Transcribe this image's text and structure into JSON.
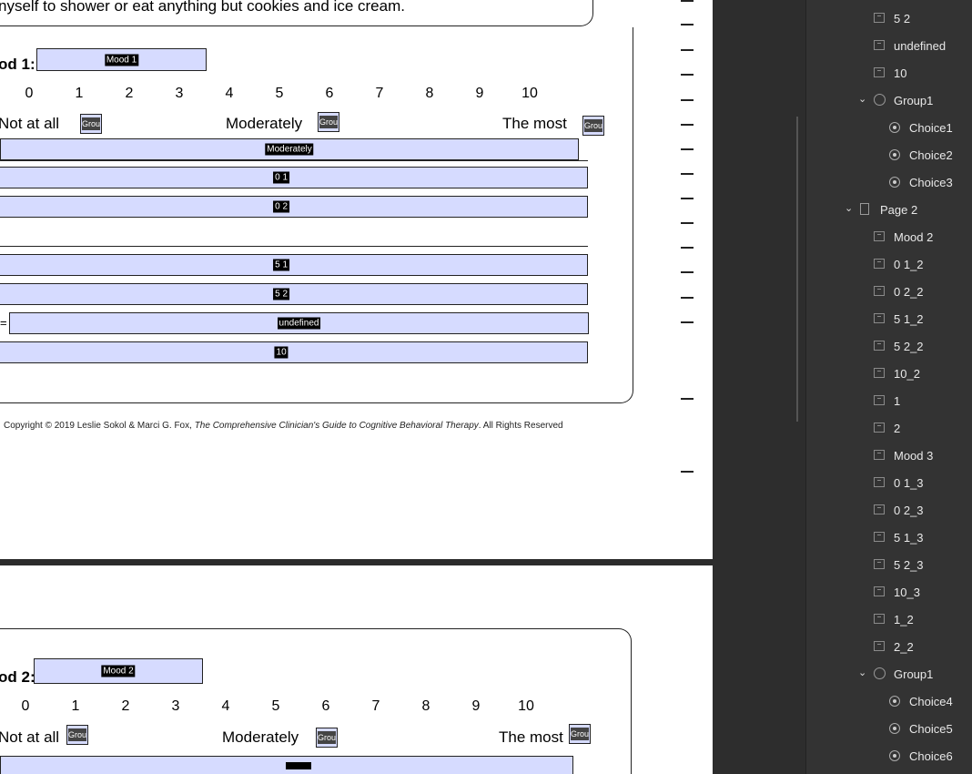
{
  "document": {
    "top_text": "nyself to shower or eat anything but cookies and ice cream.",
    "mood1": {
      "label": "od 1:",
      "field": "Mood 1",
      "scale": [
        "0",
        "1",
        "2",
        "3",
        "4",
        "5",
        "6",
        "7",
        "8",
        "9",
        "10"
      ],
      "anchors": {
        "low": "Not at all",
        "mid": "Moderately",
        "high": "The most"
      },
      "group_tag": "Grou",
      "fields": [
        "Moderately",
        "0 1",
        "0 2",
        "5 1",
        "5 2",
        "undefined",
        "10"
      ]
    },
    "copyright": "Copyright © 2019 Leslie Sokol & Marci G. Fox, ",
    "copyright_italic": "The Comprehensive Clinician's Guide to Cognitive Behavioral Therapy",
    "copyright_end": ". All Rights Reserved",
    "mood2": {
      "label": "od 2:",
      "field": "Mood 2",
      "scale": [
        "0",
        "1",
        "2",
        "3",
        "4",
        "5",
        "6",
        "7",
        "8",
        "9",
        "10"
      ],
      "anchors": {
        "low": "Not at all",
        "mid": "Moderately",
        "high": "The most"
      },
      "group_tag": "Grou"
    },
    "eq_sign": "="
  },
  "tree": {
    "items": [
      {
        "label": "5 2",
        "kind": "field"
      },
      {
        "label": "undefined",
        "kind": "field"
      },
      {
        "label": "10",
        "kind": "field"
      },
      {
        "label": "Group1",
        "kind": "group"
      },
      {
        "label": "Choice1",
        "kind": "radio"
      },
      {
        "label": "Choice2",
        "kind": "radio"
      },
      {
        "label": "Choice3",
        "kind": "radio"
      },
      {
        "label": "Page 2",
        "kind": "page"
      },
      {
        "label": "Mood 2",
        "kind": "field"
      },
      {
        "label": "0 1_2",
        "kind": "field"
      },
      {
        "label": "0 2_2",
        "kind": "field"
      },
      {
        "label": "5 1_2",
        "kind": "field"
      },
      {
        "label": "5 2_2",
        "kind": "field"
      },
      {
        "label": "10_2",
        "kind": "field"
      },
      {
        "label": "1",
        "kind": "field"
      },
      {
        "label": "2",
        "kind": "field"
      },
      {
        "label": "Mood 3",
        "kind": "field"
      },
      {
        "label": "0 1_3",
        "kind": "field"
      },
      {
        "label": "0 2_3",
        "kind": "field"
      },
      {
        "label": "5 1_3",
        "kind": "field"
      },
      {
        "label": "5 2_3",
        "kind": "field"
      },
      {
        "label": "10_3",
        "kind": "field"
      },
      {
        "label": "1_2",
        "kind": "field"
      },
      {
        "label": "2_2",
        "kind": "field"
      },
      {
        "label": "Group1",
        "kind": "group"
      },
      {
        "label": "Choice4",
        "kind": "radio"
      },
      {
        "label": "Choice5",
        "kind": "radio"
      },
      {
        "label": "Choice6",
        "kind": "radio"
      }
    ]
  }
}
